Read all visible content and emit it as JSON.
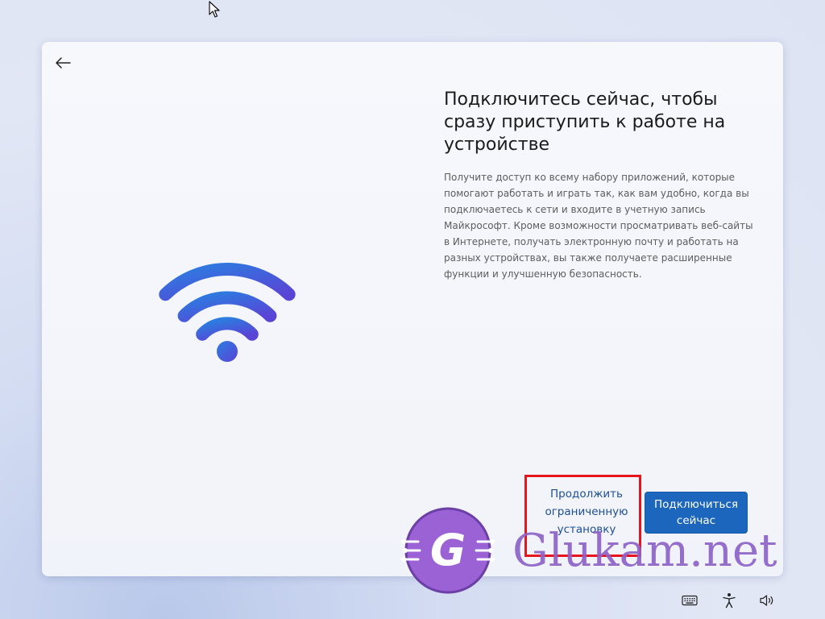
{
  "oobe": {
    "back_icon": "arrow-left-icon",
    "illustration_icon": "wifi-icon",
    "title": "Подключитесь сейчас, чтобы сразу приступить к работе на устройстве",
    "description": "Получите доступ ко всему набору приложений, которые помогают работать и играть так, как вам удобно, когда вы подключаетесь к сети и входите в учетную запись Майкрософт. Кроме возможности просматривать веб-сайты в Интернете, получать электронную почту и работать на разных устройствах, вы также получаете расширенные функции и улучшенную безопасность.",
    "limited_setup_label": "Продолжить ограниченную установку",
    "connect_now_label": "Подключиться сейчас"
  },
  "taskbar": {
    "icons": [
      "keyboard-icon",
      "accessibility-icon",
      "volume-icon"
    ]
  },
  "watermark": {
    "text": "Glukam.net",
    "logo_letter": "G"
  },
  "colors": {
    "primary_button": "#1d66bd",
    "secondary_text": "#1e4f94",
    "highlight": "#e8141c",
    "wifi_gradient_start": "#2b7de0",
    "wifi_gradient_end": "#5a44d6",
    "watermark": "#8e63c9"
  }
}
